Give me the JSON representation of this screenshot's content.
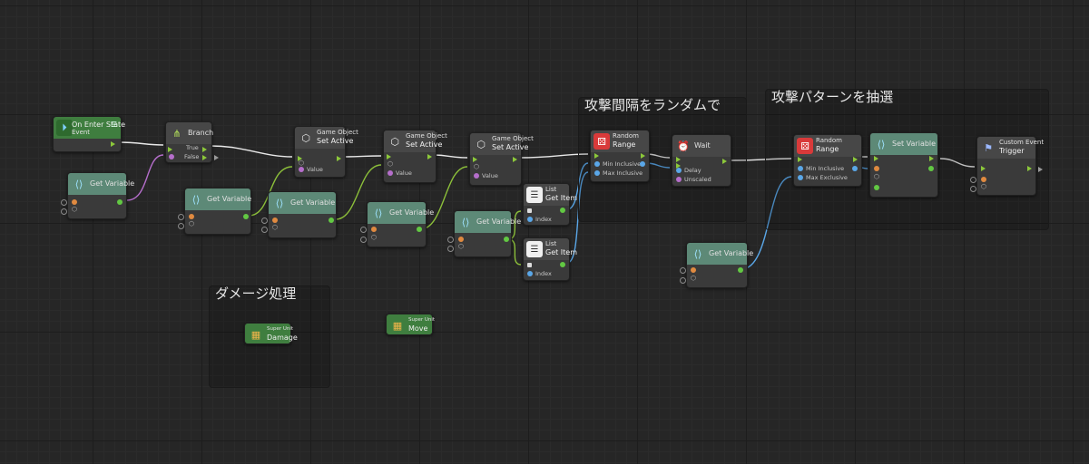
{
  "groups": [
    {
      "id": "g1",
      "title": "攻撃間隔をランダムで"
    },
    {
      "id": "g2",
      "title": "攻撃パターンを抽選"
    },
    {
      "id": "g3",
      "title": "ダメージ処理"
    }
  ],
  "nodes": {
    "on_enter_state": {
      "sub": "Event",
      "title": "On Enter State"
    },
    "branch": {
      "title": "Branch",
      "true_label": "True",
      "false_label": "False"
    },
    "get_variable": {
      "title": "Get Variable"
    },
    "set_active_1": {
      "category": "Game Object",
      "title": "Set Active",
      "value_label": "Value"
    },
    "set_active_2": {
      "category": "Game Object",
      "title": "Set Active",
      "value_label": "Value"
    },
    "set_active_3": {
      "category": "Game Object",
      "title": "Set Active",
      "value_label": "Value"
    },
    "list_get_item_1": {
      "category": "List",
      "title": "Get Item",
      "index_label": "Index"
    },
    "list_get_item_2": {
      "category": "List",
      "title": "Get Item",
      "index_label": "Index"
    },
    "random_range_1": {
      "category": "Random",
      "title": "Range",
      "min_label": "Min Inclusive",
      "max_label": "Max Inclusive"
    },
    "wait": {
      "title": "Wait",
      "delay_label": "Delay",
      "unscaled_label": "Unscaled"
    },
    "random_range_2": {
      "category": "Random",
      "title": "Range",
      "min_label": "Min Inclusive",
      "max_label": "Max Exclusive"
    },
    "set_variable": {
      "title": "Set Variable"
    },
    "custom_event": {
      "category": "Custom Event",
      "title": "Trigger"
    },
    "super_unit_damage": {
      "category": "Super Unit",
      "title": "Damage"
    },
    "super_unit_move": {
      "category": "Super Unit",
      "title": "Move"
    }
  },
  "colors": {
    "control": "#8cc83a",
    "float": "#e08a40",
    "bool": "#b56ecb",
    "number": "#5aa7e8",
    "object": "#62c843",
    "accent_green": "#3f7e3f",
    "accent_teal": "#5d8977"
  },
  "icons": {
    "event": "event-flag-icon",
    "branch": "branch-icon",
    "variable": "variable-icon",
    "gameobject": "cube-icon",
    "list": "list-icon",
    "random": "dice-icon",
    "wait": "alarm-clock-icon",
    "custom_event": "custom-event-icon",
    "super_unit": "super-unit-icon"
  }
}
